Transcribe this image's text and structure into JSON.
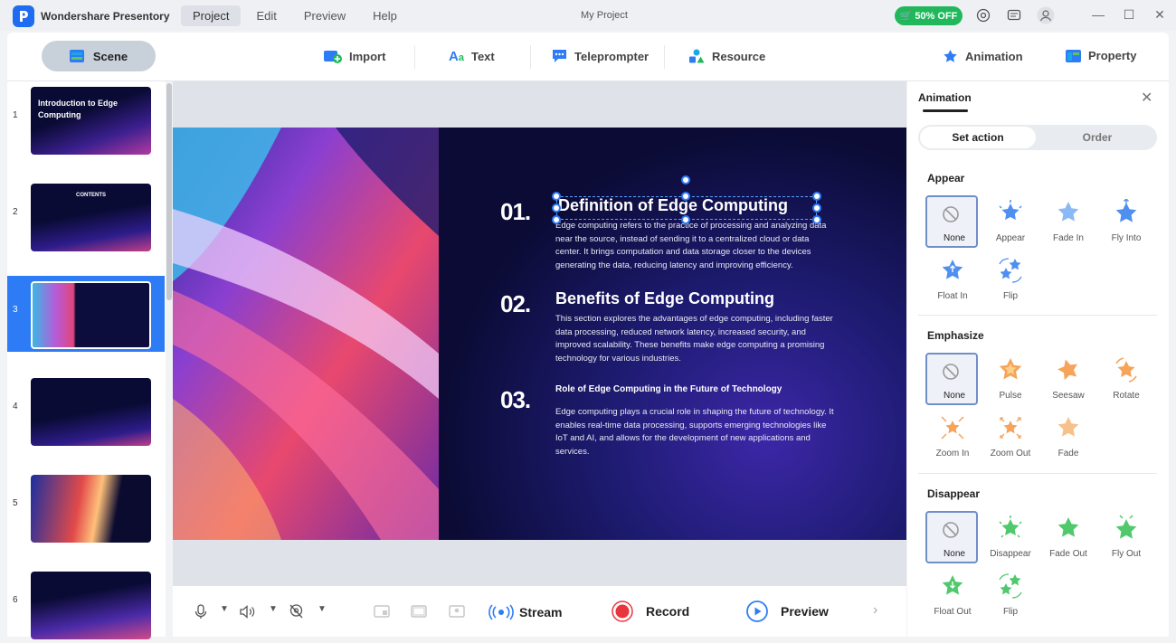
{
  "app": {
    "name": "Wondershare Presentory",
    "document_title": "My Project"
  },
  "menu": [
    {
      "label": "Project"
    },
    {
      "label": "Edit"
    },
    {
      "label": "Preview"
    },
    {
      "label": "Help"
    }
  ],
  "promo": {
    "label": "50% OFF"
  },
  "toolbar": {
    "scene": "Scene",
    "import": "Import",
    "text": "Text",
    "teleprompter": "Teleprompter",
    "resource": "Resource",
    "animation": "Animation",
    "property": "Property"
  },
  "slides": [
    {
      "num": "1",
      "title": "Introduction to Edge Computing"
    },
    {
      "num": "2",
      "title": "CONTENTS"
    },
    {
      "num": "3",
      "title": ""
    },
    {
      "num": "4",
      "title": ""
    },
    {
      "num": "5",
      "title": ""
    },
    {
      "num": "6",
      "title": ""
    }
  ],
  "canvas": {
    "sections": [
      {
        "number": "01.",
        "title": "Definition of Edge Computing",
        "body": "Edge computing refers to the practice of processing and analyzing data near the source, instead of sending it to a centralized cloud or data center. It brings computation and data storage closer to the devices generating the data, reducing latency and improving efficiency."
      },
      {
        "number": "02.",
        "title": "Benefits of Edge Computing",
        "body": "This section explores the advantages of edge computing, including faster data processing, reduced network latency, increased security, and improved scalability. These benefits make edge computing a promising technology for various industries."
      },
      {
        "number": "03.",
        "title": "Role of Edge Computing in the Future of Technology",
        "body": "Edge computing plays a crucial role in shaping the future of technology. It enables real-time data processing, supports emerging technologies like IoT and AI, and allows for the development of new applications and services."
      }
    ]
  },
  "bottombar": {
    "stream": "Stream",
    "record": "Record",
    "preview": "Preview"
  },
  "panel": {
    "title": "Animation",
    "tabs": [
      "Set action",
      "Order"
    ],
    "groups": [
      {
        "title": "Appear",
        "items": [
          "None",
          "Appear",
          "Fade In",
          "Fly Into",
          "Float In",
          "Flip"
        ]
      },
      {
        "title": "Emphasize",
        "items": [
          "None",
          "Pulse",
          "Seesaw",
          "Rotate",
          "Zoom In",
          "Zoom Out",
          "Fade"
        ]
      },
      {
        "title": "Disappear",
        "items": [
          "None",
          "Disappear",
          "Fade Out",
          "Fly Out",
          "Float Out",
          "Flip"
        ]
      }
    ]
  },
  "colors": {
    "accent": "#2d7cf6",
    "promo": "#21b85c",
    "appear_star": "#4f8ff0",
    "emphasize_star": "#f5a45a",
    "disappear_star": "#4fc96b",
    "record": "#e8363c"
  }
}
